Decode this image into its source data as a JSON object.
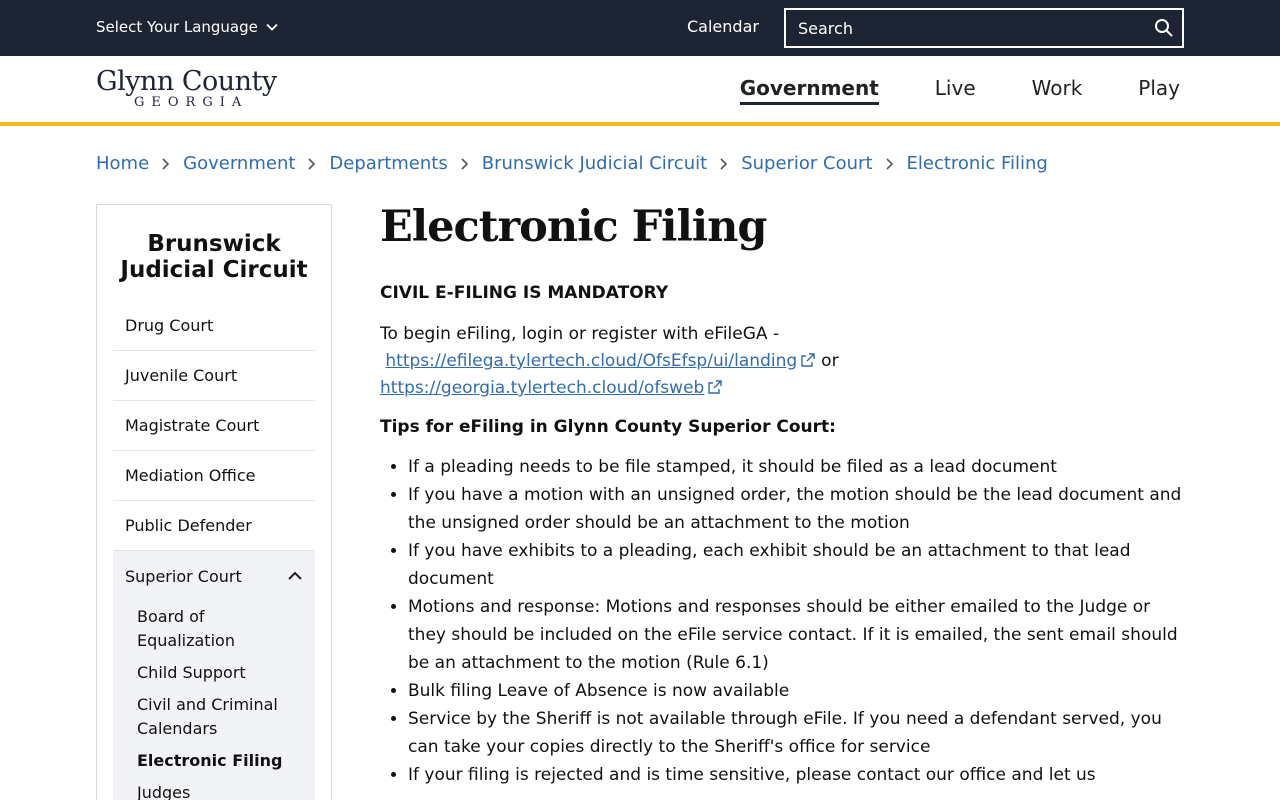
{
  "topbar": {
    "language_label": "Select Your Language",
    "calendar_label": "Calendar",
    "search_placeholder": "Search"
  },
  "header": {
    "logo_line1": "Glynn County",
    "logo_line2": "GEORGIA",
    "nav": [
      {
        "label": "Government",
        "active": true
      },
      {
        "label": "Live"
      },
      {
        "label": "Work"
      },
      {
        "label": "Play"
      }
    ]
  },
  "breadcrumb": [
    "Home",
    "Government",
    "Departments",
    "Brunswick Judicial Circuit",
    "Superior Court",
    "Electronic Filing"
  ],
  "sidebar": {
    "title": "Brunswick Judicial Circuit",
    "items": [
      "Drug Court",
      "Juvenile Court",
      "Magistrate Court",
      "Mediation Office",
      "Public Defender"
    ],
    "expanded_group": {
      "label": "Superior Court",
      "children": [
        "Board of Equalization",
        "Child Support",
        "Civil and Criminal Calendars",
        "Electronic Filing",
        "Judges"
      ]
    }
  },
  "content": {
    "title": "Electronic Filing",
    "mandatory_heading": "CIVIL E-FILING IS MANDATORY",
    "intro_text": "To begin eFiling, login or register with eFileGA - ",
    "link1": "https://efilega.tylertech.cloud/OfsEfsp/ui/landing",
    "or_text": "or",
    "link2": "https://georgia.tylertech.cloud/ofsweb",
    "tips_heading": "Tips for eFiling in Glynn County Superior Court:",
    "tips": [
      "If a pleading needs to be file stamped, it should be filed as a lead document",
      "If you have a motion with an unsigned order, the motion should be the lead document and the unsigned order should be an attachment to the motion",
      "If you have exhibits to a pleading, each exhibit should be an attachment to that lead document",
      "Motions and response: Motions and responses should be either emailed to the Judge or they should be included on the eFile service contact.  If it is emailed, the sent email should be an attachment to the motion (Rule 6.1)",
      "Bulk filing Leave of Absence is now available",
      "Service by the Sheriff is not available through eFile.  If you need a defendant served, you can take your copies directly to the Sheriff's office for service",
      "If your filing is rejected and is time sensitive, please contact our office and let us"
    ]
  },
  "colors": {
    "topbar_bg": "#1d2433",
    "accent_yellow": "#f2bb1b",
    "link_blue": "#2f6cb0"
  }
}
